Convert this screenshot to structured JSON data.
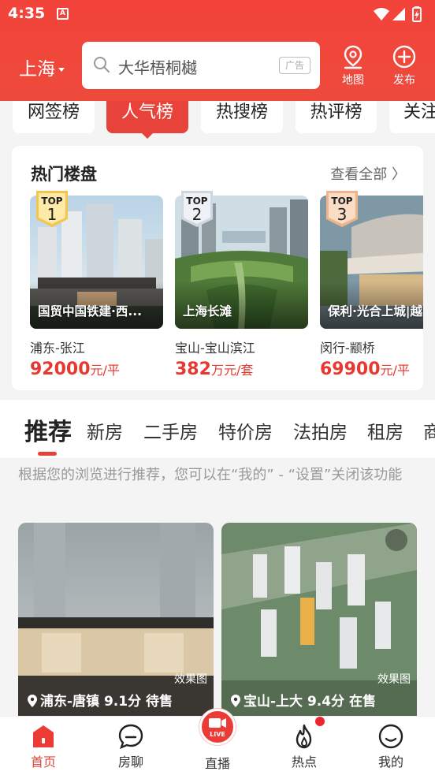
{
  "status": {
    "time": "4:35",
    "notification_icon": "A"
  },
  "header": {
    "city": "上海",
    "search_text": "大华梧桐樾",
    "ad_label": "广告",
    "map_label": "地图",
    "publish_label": "发布"
  },
  "rank_tabs": [
    "网签榜",
    "人气榜",
    "热搜榜",
    "热评榜",
    "关注"
  ],
  "hot": {
    "title": "热门楼盘",
    "view_all": "查看全部 〉",
    "items": [
      {
        "rank_top": "TOP",
        "rank": "1",
        "name": "国贸中国铁建·西...",
        "location": "浦东-张江",
        "price": "92000",
        "unit": "元/平"
      },
      {
        "rank_top": "TOP",
        "rank": "2",
        "name": "上海长滩",
        "location": "宝山-宝山滨江",
        "price": "382",
        "unit": "万元/套"
      },
      {
        "rank_top": "TOP",
        "rank": "3",
        "name": "保利·光合上城|越",
        "location": "闵行-颛桥",
        "price": "69900",
        "unit": "元/平"
      }
    ]
  },
  "categories": [
    "推荐",
    "新房",
    "二手房",
    "特价房",
    "法拍房",
    "租房",
    "商"
  ],
  "note": "根据您的浏览进行推荐，您可以在“我的” - “设置”关闭该功能",
  "listings": [
    {
      "tag": "效果图",
      "info": "浦东-唐镇  9.1分  待售"
    },
    {
      "tag": "效果图",
      "info": "宝山-上大  9.4分  在售"
    }
  ],
  "nav": {
    "home": "首页",
    "chat": "房聊",
    "live": "直播",
    "live_badge": "LIVE",
    "hot": "热点",
    "me": "我的"
  },
  "colors": {
    "brand": "#e8433a",
    "price": "#e8382f"
  }
}
